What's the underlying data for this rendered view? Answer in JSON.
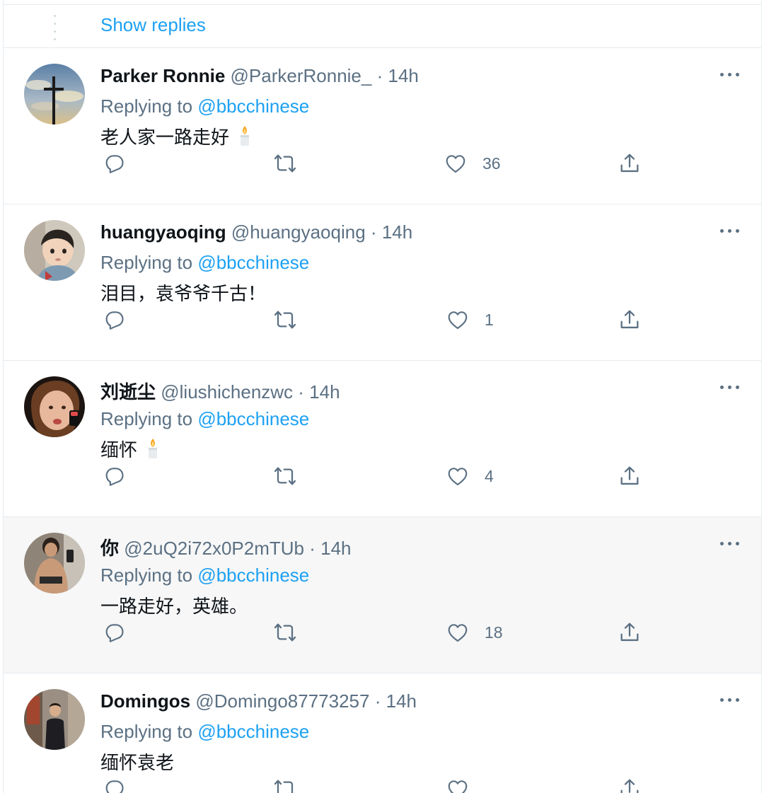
{
  "thread": {
    "show_replies_label": "Show replies"
  },
  "colors": {
    "accent": "#1da1f2",
    "secondary_text": "#5b7083",
    "border": "#e6ecf0",
    "hover_bg": "#f7f7f7"
  },
  "tweets": [
    {
      "name": "Parker Ronnie",
      "handle": "@ParkerRonnie_",
      "separator": "·",
      "time": "14h",
      "replying_label": "Replying to",
      "replying_to": "@bbcchinese",
      "text": "老人家一路走好",
      "emoji": "candle-icon",
      "like_count": "36",
      "avatar": "cross-avatar"
    },
    {
      "name": "huangyaoqing",
      "handle": "@huangyaoqing",
      "separator": "·",
      "time": "14h",
      "replying_label": "Replying to",
      "replying_to": "@bbcchinese",
      "text": "泪目，袁爷爷千古！",
      "emoji": "",
      "like_count": "1",
      "avatar": "child-avatar"
    },
    {
      "name": "刘逝尘",
      "handle": "@liushichenzwc",
      "separator": "·",
      "time": "14h",
      "replying_label": "Replying to",
      "replying_to": "@bbcchinese",
      "text": "缅怀",
      "emoji": "candle-icon",
      "like_count": "4",
      "avatar": "portrait-avatar"
    },
    {
      "name": "你",
      "handle": "@2uQ2i72x0P2mTUb",
      "separator": "·",
      "time": "14h",
      "replying_label": "Replying to",
      "replying_to": "@bbcchinese",
      "text": "一路走好，英雄。",
      "emoji": "",
      "like_count": "18",
      "avatar": "selfie-avatar"
    },
    {
      "name": "Domingos",
      "handle": "@Domingo87773257",
      "separator": "·",
      "time": "14h",
      "replying_label": "Replying to",
      "replying_to": "@bbcchinese",
      "text": "缅怀袁老",
      "emoji": "",
      "like_count": "",
      "avatar": "street-avatar"
    }
  ],
  "icons": {
    "reply": "reply-icon",
    "retweet": "retweet-icon",
    "like": "heart-icon",
    "share": "share-icon",
    "more": "more-icon"
  }
}
